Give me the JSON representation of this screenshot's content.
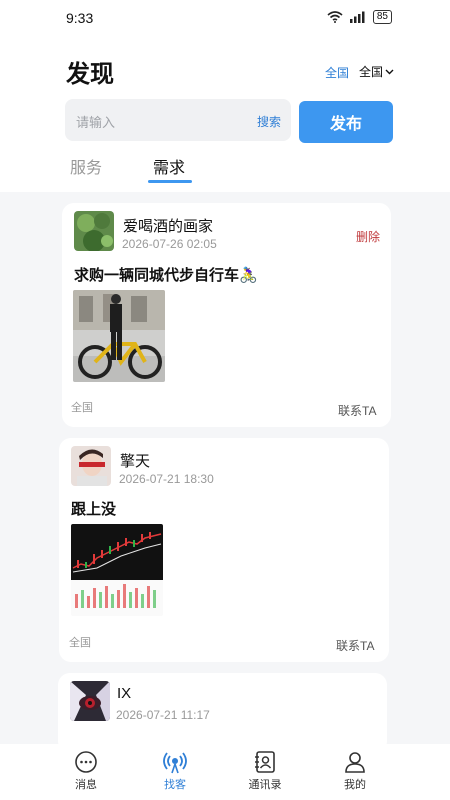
{
  "status": {
    "time": "9:33",
    "battery": "85"
  },
  "header": {
    "title": "发现",
    "region_link": "全国",
    "region_select": "全国"
  },
  "search": {
    "placeholder": "请输入",
    "search_label": "搜索",
    "publish_label": "发布"
  },
  "tabs": [
    {
      "label": "服务"
    },
    {
      "label": "需求"
    }
  ],
  "posts": [
    {
      "user": "爱喝酒的画家",
      "time": "2026-07-26 02:05",
      "delete_label": "删除",
      "title": "求购一辆同城代步自行车🚴‍♀️",
      "region": "全国",
      "contact_label": "联系TA"
    },
    {
      "user": "擎天",
      "time": "2026-07-21 18:30",
      "title": "跟上没",
      "region": "全国",
      "contact_label": "联系TA"
    },
    {
      "user": "IX",
      "time": "2026-07-21 11:17"
    }
  ],
  "bottom_nav": [
    {
      "label": "消息",
      "icon": "chat-bubble-icon"
    },
    {
      "label": "找客",
      "icon": "broadcast-icon"
    },
    {
      "label": "通讯录",
      "icon": "contacts-icon"
    },
    {
      "label": "我的",
      "icon": "person-icon"
    }
  ],
  "colors": {
    "accent": "#3d97f0",
    "link": "#2f7fd6",
    "delete": "#c0393b"
  }
}
